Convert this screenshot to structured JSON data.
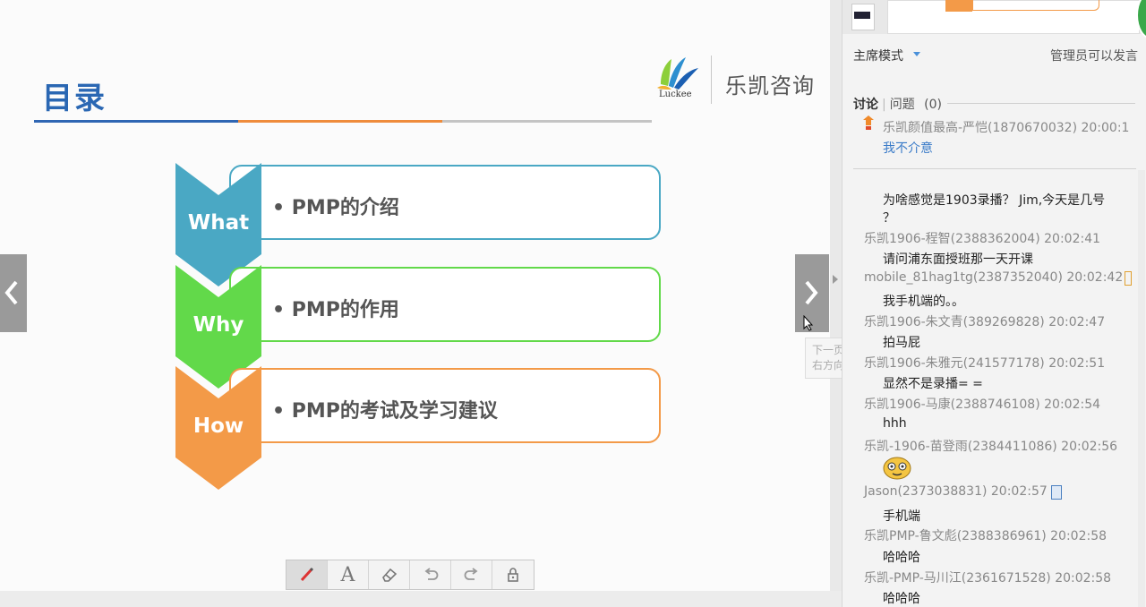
{
  "slide": {
    "title": "目录",
    "logo_cn": "乐凯咨询",
    "logo_en": "Luckee",
    "rows": [
      {
        "label": "What",
        "text": "• PMP的介绍",
        "color": "#4aa8c4"
      },
      {
        "label": "Why",
        "text": "• PMP的作用",
        "color": "#62d94a"
      },
      {
        "label": "How",
        "text": "• PMP的考试及学习建议",
        "color": "#f39a48"
      }
    ]
  },
  "tooltip": {
    "line1": "下一页",
    "line2": "右方向键或鼠标滚轮向下"
  },
  "toolbar": {
    "tools": [
      "pen-icon",
      "text-icon",
      "eraser-icon",
      "undo-icon",
      "redo-icon",
      "lock-icon"
    ],
    "text_tool_glyph": "A"
  },
  "panel": {
    "mode": "主席模式",
    "admin_note": "管理员可以发言",
    "tab_discuss": "讨论",
    "tab_questions": "问题",
    "question_count": "(0)",
    "pinned": {
      "meta": "乐凯颜值最高-严恺(1870670032) 20:00:1",
      "body": "我不介意"
    },
    "messages": [
      {
        "body": "为啥感觉是1903录播？ Jim,今天是几号",
        "meta": ""
      },
      {
        "body": "？",
        "meta": "乐凯1906-程智(2388362004) 20:02:41"
      },
      {
        "body": "请问浦东面授班那一天开课",
        "meta": "mobile_81hag1tg(2387352040) 20:02:42"
      },
      {
        "body": "我手机端的。。",
        "meta": "乐凯1906-朱文青(389269828) 20:02:47"
      },
      {
        "body": "拍马屁",
        "meta": "乐凯1906-朱雅元(241577178) 20:02:51"
      },
      {
        "body": "显然不是录播= =",
        "meta": "乐凯1906-马康(2388746108) 20:02:54"
      },
      {
        "body": "hhh",
        "meta": "乐凯-1906-苗登雨(2384411086) 20:02:56"
      },
      {
        "body": "",
        "meta": "Jason(2373038831) 20:02:57"
      },
      {
        "body": "手机端",
        "meta": "乐凯PMP-鲁文彪(2388386961) 20:02:58"
      },
      {
        "body": "哈哈哈",
        "meta": "乐凯-PMP-马川江(2361671528) 20:02:58"
      },
      {
        "body": "哈哈哈",
        "meta": ""
      }
    ]
  }
}
